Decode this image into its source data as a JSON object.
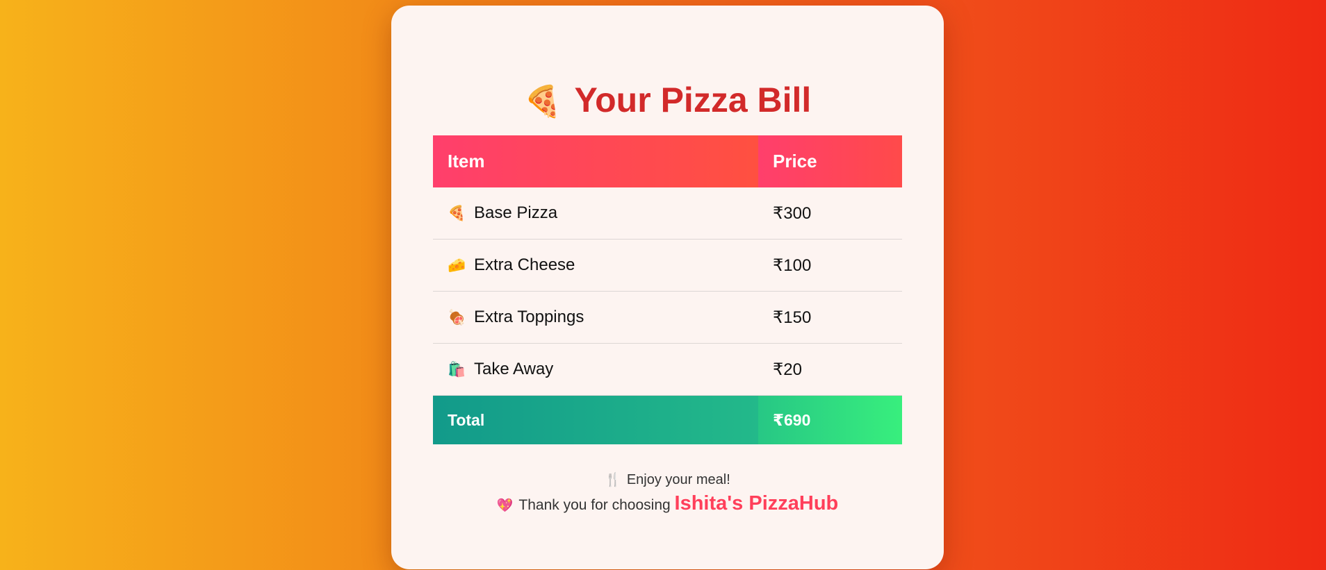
{
  "title": {
    "icon": "pizza-icon",
    "icon_glyph": "🍕",
    "text": "Your Pizza Bill"
  },
  "table": {
    "headers": [
      "Item",
      "Price"
    ],
    "rows": [
      {
        "icon": "pizza-icon",
        "glyph": "🍕",
        "item": "Base Pizza",
        "price": "₹300"
      },
      {
        "icon": "cheese-icon",
        "glyph": "🧀",
        "item": "Extra Cheese",
        "price": "₹100"
      },
      {
        "icon": "meat-icon",
        "glyph": "🍖",
        "item": "Extra Toppings",
        "price": "₹150"
      },
      {
        "icon": "shopping-bag-icon",
        "glyph": "🛍️",
        "item": "Take Away",
        "price": "₹20"
      }
    ],
    "total": {
      "label": "Total",
      "value": "₹690"
    }
  },
  "footer": {
    "line1_icon": "fork-knife-icon",
    "line1_glyph": "🍴",
    "line1_text": "Enjoy your meal!",
    "line2_icon": "heart-icon",
    "line2_glyph": "💖",
    "line2_text": "Thank you for choosing",
    "brand": "Ishita's PizzaHub"
  },
  "colors": {
    "title": "#d22a2a",
    "header_gradient_start": "#ff3f6c",
    "header_gradient_end": "#ff4a4a",
    "total_gradient_start": "#129a8a",
    "total_gradient_end": "#38ef7d",
    "brand": "#ff3f5a",
    "card_background": "#fdf4f1"
  }
}
